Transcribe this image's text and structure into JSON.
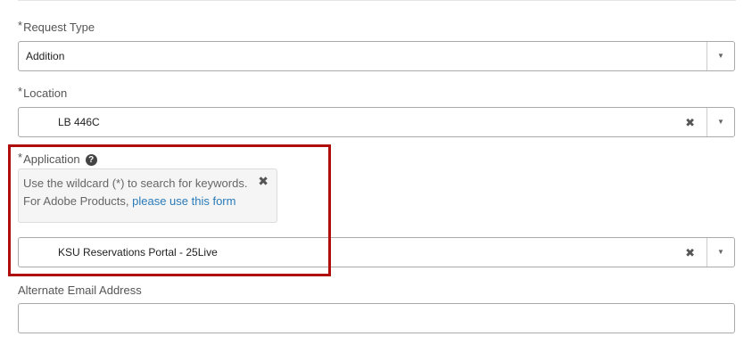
{
  "form": {
    "request_type": {
      "required_mark": "*",
      "label": "Request Type",
      "value": "Addition",
      "arrow": "▼"
    },
    "location": {
      "required_mark": "*",
      "label": "Location",
      "value": "LB 446C",
      "clear": "✖",
      "arrow": "▼"
    },
    "application": {
      "required_mark": "*",
      "label": "Application",
      "help_icon": "?",
      "hint": {
        "line1": "Use the wildcard (*) to search for keywords.",
        "line2_prefix": "For Adobe Products, ",
        "link_text": "please use this form",
        "close": "✖"
      },
      "value": "KSU Reservations Portal - 25Live",
      "clear": "✖",
      "arrow": "▼"
    },
    "alternate_email": {
      "label": "Alternate Email Address",
      "value": "",
      "placeholder": ""
    }
  },
  "annotation": {
    "highlight_color": "#b00d0d"
  }
}
